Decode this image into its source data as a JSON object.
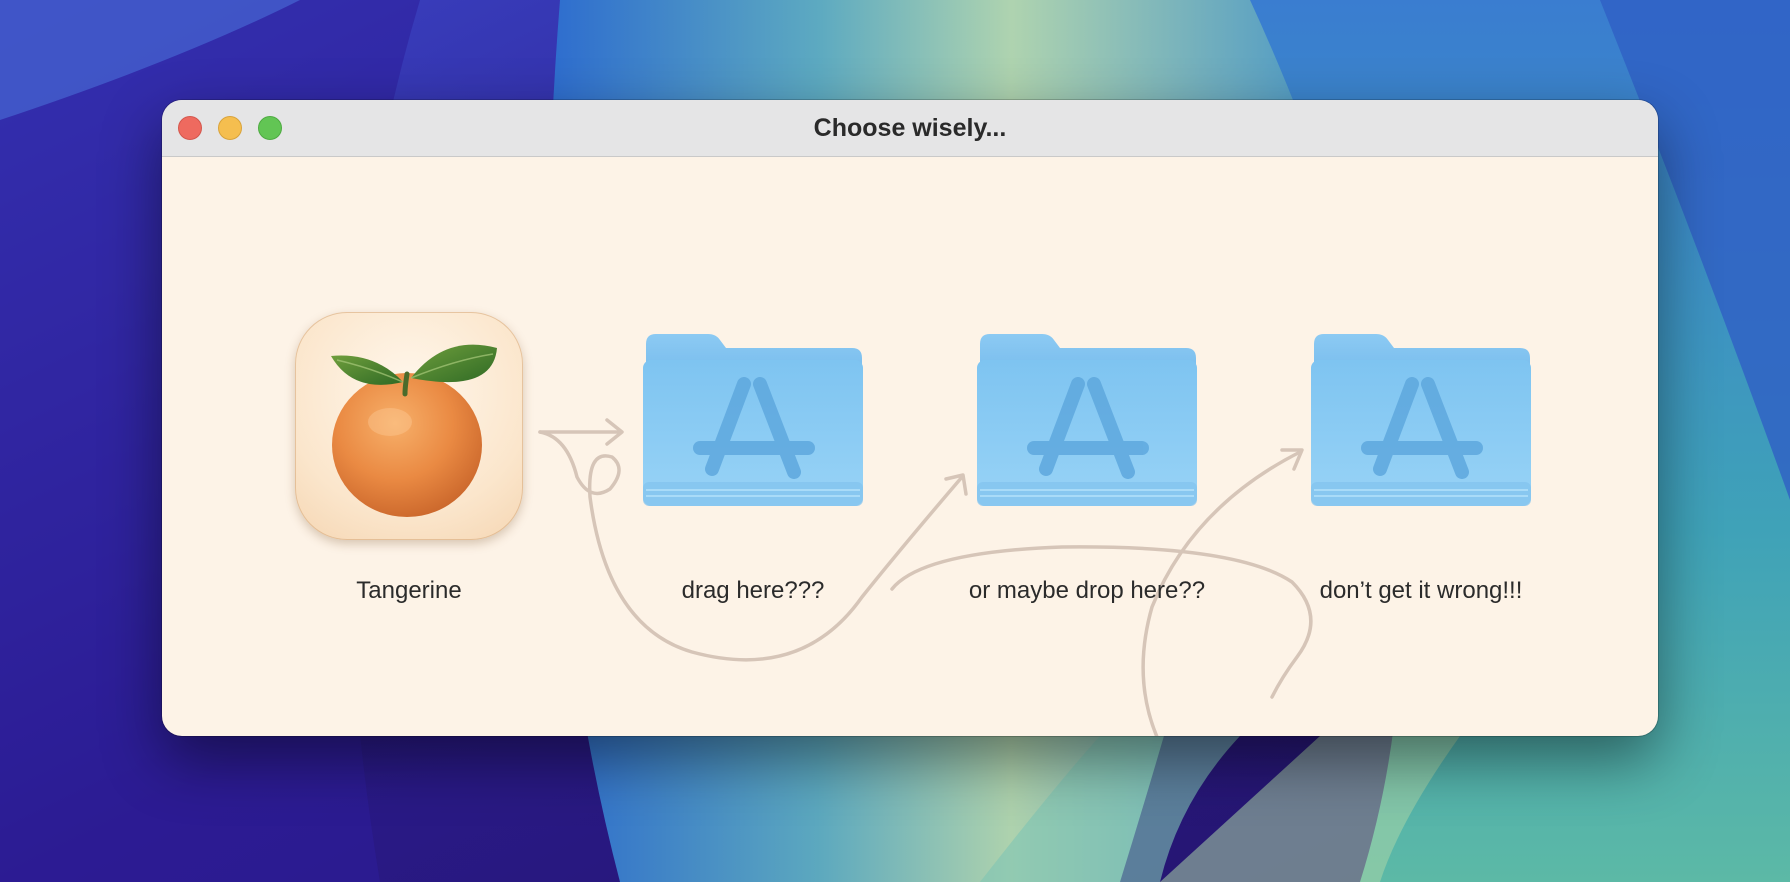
{
  "window": {
    "title": "Choose wisely..."
  },
  "items": [
    {
      "label": "Tangerine",
      "icon": "tangerine-app-icon"
    },
    {
      "label": "drag here???",
      "icon": "applications-folder-icon"
    },
    {
      "label": "or maybe drop here??",
      "icon": "applications-folder-icon"
    },
    {
      "label": "don’t get it wrong!!!",
      "icon": "applications-folder-icon"
    }
  ],
  "colors": {
    "window_background": "#fdf3e7",
    "titlebar": "#e5e5e6",
    "folder_blue": "#86c8f2",
    "arrow_stroke": "#d6c5b8",
    "close": "#ee6a5f",
    "minimize": "#f5be4f",
    "maximize": "#62c554"
  }
}
